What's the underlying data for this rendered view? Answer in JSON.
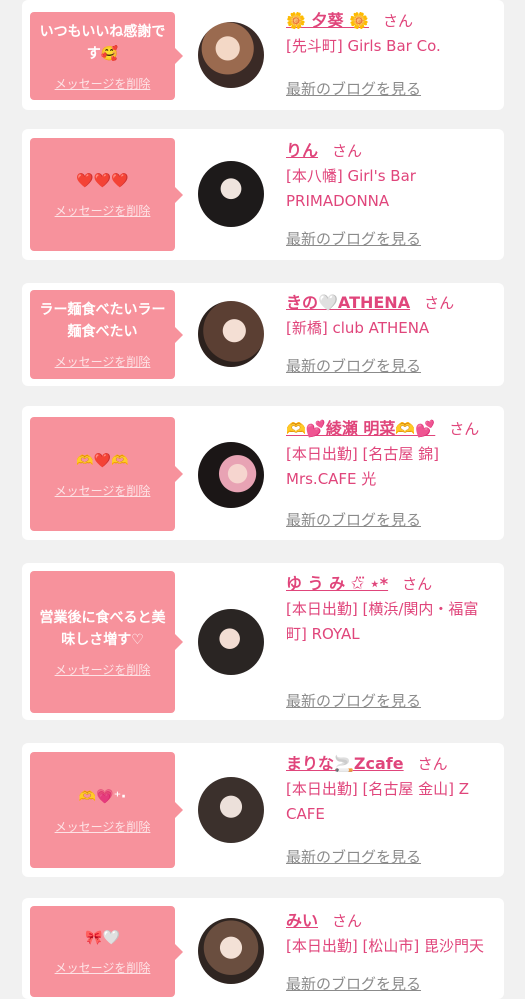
{
  "delete_label": "メッセージを削除",
  "blog_label": "最新のブログを見る",
  "san": "さん",
  "cards": [
    {
      "message": "いつもいいね感謝です🥰",
      "name": "🌼 夕葵 🌼",
      "sub": "[先斗町] Girls Bar Co."
    },
    {
      "message": "❤️❤️❤️",
      "name": "りん",
      "sub": "[本八幡] Girl's Bar PRIMADONNA"
    },
    {
      "message": "ラー麺食べたいラー麺食べたい",
      "name": "きの🤍ATHENA",
      "sub": "[新橋] club ATHENA"
    },
    {
      "message": "🫶❤️🫶",
      "name": "🫶💕綾瀬 明菜🫶💕",
      "sub": "[本日出勤] [名古屋 錦] Mrs.CAFE 光"
    },
    {
      "message": "営業後に食べると美味しさ増す♡",
      "name": "ゆ う み ✩⃛ ⋆*",
      "sub": "[本日出勤] [横浜/関内・福富町] ROYAL"
    },
    {
      "message": "🫶💗⁺‧",
      "name": "まりな🚬Zcafe",
      "sub": "[本日出勤] [名古屋 金山] Z CAFE"
    },
    {
      "message": "🎀🤍",
      "name": "みい",
      "sub": "[本日出勤] [松山市] 毘沙門天"
    }
  ]
}
